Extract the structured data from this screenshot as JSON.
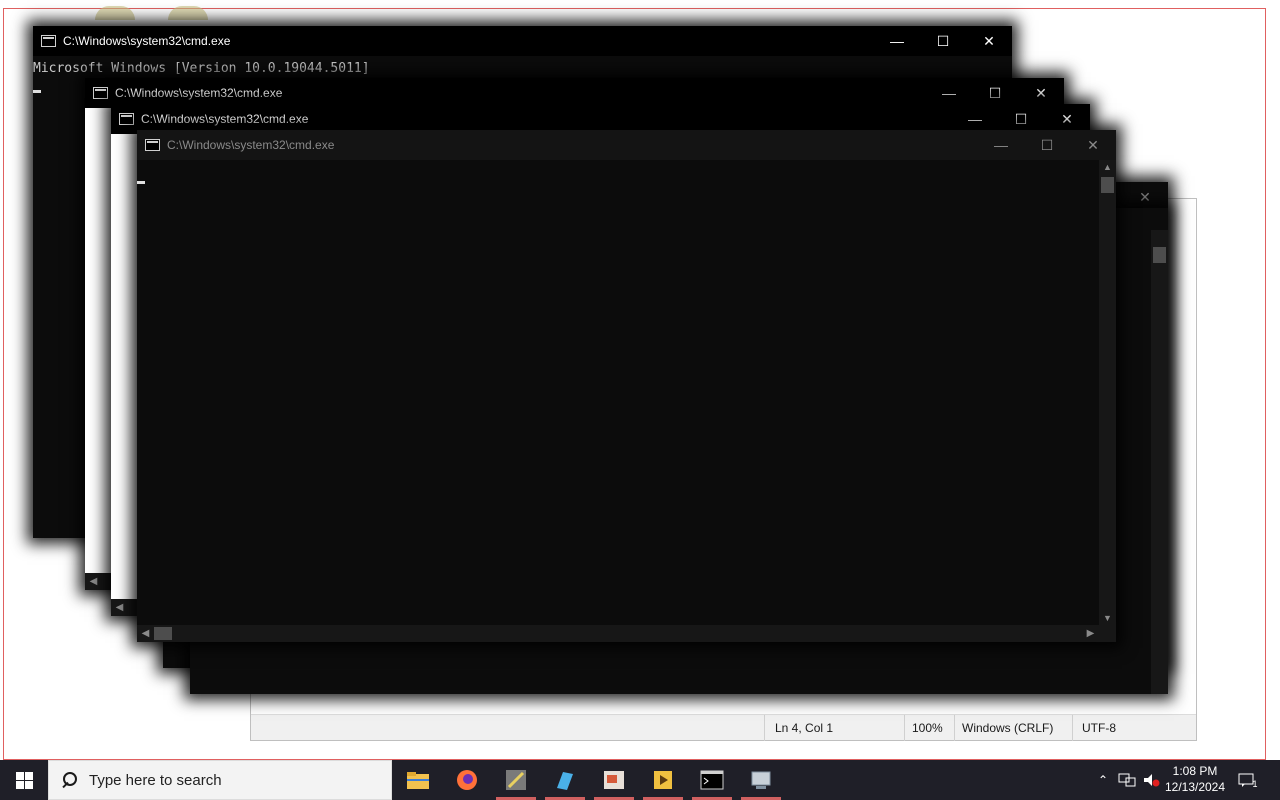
{
  "notepad": {
    "status_position": "Ln 4, Col 1",
    "status_zoom": "100%",
    "status_line_ending": "Windows (CRLF)",
    "status_encoding": "UTF-8"
  },
  "cmd_windows": [
    {
      "title": "C:\\Windows\\system32\\cmd.exe",
      "console_line": "Microsoft Windows [Version 10.0.19044.5011]"
    },
    {
      "title": "C:\\Windows\\system32\\cmd.exe"
    },
    {
      "title": "C:\\Windows\\system32\\cmd.exe"
    },
    {
      "title": "C:\\Windows\\system32\\cmd.exe"
    }
  ],
  "window_controls": {
    "minimize": "—",
    "maximize": "☐",
    "close": "✕"
  },
  "taskbar": {
    "search_placeholder": "Type here to search",
    "apps": [
      "file-explorer",
      "firefox",
      "media-tool",
      "paint-tool",
      "presentation-app",
      "video-player",
      "terminal",
      "network-app"
    ],
    "time": "1:08 PM",
    "date": "12/13/2024",
    "notification_count": "1"
  },
  "colors": {
    "taskbar": "#1f1f28",
    "console_bg": "#0c0c0c",
    "accent_underline": "#d06060"
  }
}
